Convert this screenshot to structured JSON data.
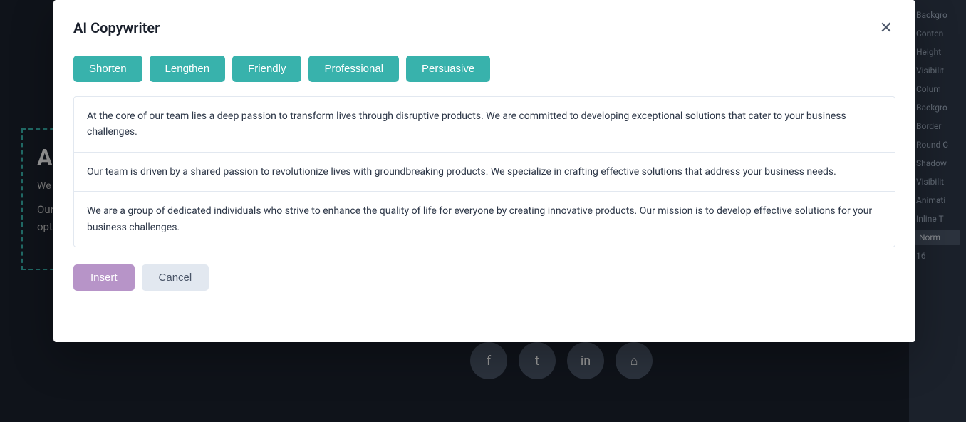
{
  "modal": {
    "title": "AI Copywriter",
    "close_icon": "✕",
    "action_buttons": [
      {
        "label": "Shorten",
        "id": "shorten"
      },
      {
        "label": "Lengthen",
        "id": "lengthen"
      },
      {
        "label": "Friendly",
        "id": "friendly"
      },
      {
        "label": "Professional",
        "id": "professional"
      },
      {
        "label": "Persuasive",
        "id": "persuasive"
      }
    ],
    "text_options": [
      {
        "text": "At the core of our team lies a deep passion to transform lives through disruptive products. We are committed to developing exceptional solutions that cater to your business challenges."
      },
      {
        "text": "Our team is driven by a shared passion to revolutionize lives with groundbreaking products. We specialize in crafting effective solutions that address your business needs."
      },
      {
        "text": "We are a group of dedicated individuals who strive to enhance the quality of life for everyone by creating innovative products. Our mission is to develop effective solutions for your business challenges."
      }
    ],
    "insert_label": "Insert",
    "cancel_label": "Cancel"
  },
  "sidebar": {
    "items": [
      {
        "label": "Backgro"
      },
      {
        "label": "Conten"
      },
      {
        "label": "Height"
      },
      {
        "label": "Visibilit"
      },
      {
        "label": "Colum"
      },
      {
        "label": "Backgro"
      },
      {
        "label": "Border"
      },
      {
        "label": "Round C"
      },
      {
        "label": "Shadow"
      },
      {
        "label": "Visibilit"
      },
      {
        "label": "Animati"
      },
      {
        "label": "Inline T"
      },
      {
        "label": "Norm"
      },
      {
        "label": "16"
      }
    ]
  },
  "canvas": {
    "about_title": "Ab",
    "about_partial": "We\neve\npr",
    "about_products": "Our products are designed for small to medium size companies willing to optimize their performance."
  },
  "social": {
    "facebook": "f",
    "twitter": "t",
    "linkedin": "in",
    "home": "⌂"
  }
}
